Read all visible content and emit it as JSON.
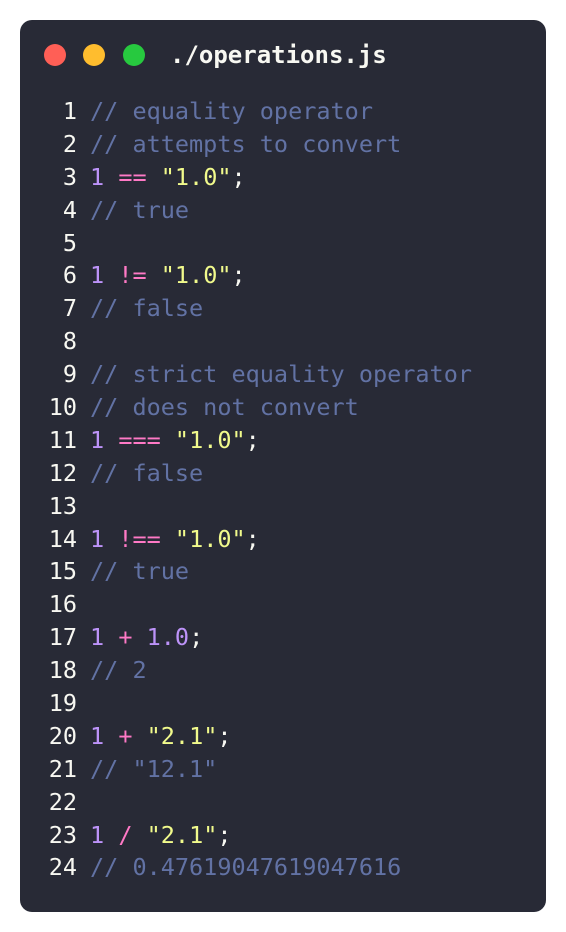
{
  "window": {
    "filename": "./operations.js"
  },
  "colors": {
    "background": "#282a36",
    "comment": "#6272a4",
    "number": "#bd93f9",
    "operator": "#ff79c6",
    "string": "#f1fa8c",
    "foreground": "#f8f8f2"
  },
  "lines": [
    {
      "n": "1",
      "tokens": [
        {
          "t": "comment",
          "v": "// equality operator"
        }
      ]
    },
    {
      "n": "2",
      "tokens": [
        {
          "t": "comment",
          "v": "// attempts to convert"
        }
      ]
    },
    {
      "n": "3",
      "tokens": [
        {
          "t": "number",
          "v": "1"
        },
        {
          "t": "space",
          "v": " "
        },
        {
          "t": "op",
          "v": "=="
        },
        {
          "t": "space",
          "v": " "
        },
        {
          "t": "string",
          "v": "\"1.0\""
        },
        {
          "t": "punct",
          "v": ";"
        }
      ]
    },
    {
      "n": "4",
      "tokens": [
        {
          "t": "comment",
          "v": "// true"
        }
      ]
    },
    {
      "n": "5",
      "tokens": []
    },
    {
      "n": "6",
      "tokens": [
        {
          "t": "number",
          "v": "1"
        },
        {
          "t": "space",
          "v": " "
        },
        {
          "t": "op",
          "v": "!="
        },
        {
          "t": "space",
          "v": " "
        },
        {
          "t": "string",
          "v": "\"1.0\""
        },
        {
          "t": "punct",
          "v": ";"
        }
      ]
    },
    {
      "n": "7",
      "tokens": [
        {
          "t": "comment",
          "v": "// false"
        }
      ]
    },
    {
      "n": "8",
      "tokens": []
    },
    {
      "n": "9",
      "tokens": [
        {
          "t": "comment",
          "v": "// strict equality operator"
        }
      ]
    },
    {
      "n": "10",
      "tokens": [
        {
          "t": "comment",
          "v": "// does not convert"
        }
      ]
    },
    {
      "n": "11",
      "tokens": [
        {
          "t": "number",
          "v": "1"
        },
        {
          "t": "space",
          "v": " "
        },
        {
          "t": "op",
          "v": "==="
        },
        {
          "t": "space",
          "v": " "
        },
        {
          "t": "string",
          "v": "\"1.0\""
        },
        {
          "t": "punct",
          "v": ";"
        }
      ]
    },
    {
      "n": "12",
      "tokens": [
        {
          "t": "comment",
          "v": "// false"
        }
      ]
    },
    {
      "n": "13",
      "tokens": []
    },
    {
      "n": "14",
      "tokens": [
        {
          "t": "number",
          "v": "1"
        },
        {
          "t": "space",
          "v": " "
        },
        {
          "t": "op",
          "v": "!=="
        },
        {
          "t": "space",
          "v": " "
        },
        {
          "t": "string",
          "v": "\"1.0\""
        },
        {
          "t": "punct",
          "v": ";"
        }
      ]
    },
    {
      "n": "15",
      "tokens": [
        {
          "t": "comment",
          "v": "// true"
        }
      ]
    },
    {
      "n": "16",
      "tokens": []
    },
    {
      "n": "17",
      "tokens": [
        {
          "t": "number",
          "v": "1"
        },
        {
          "t": "space",
          "v": " "
        },
        {
          "t": "op",
          "v": "+"
        },
        {
          "t": "space",
          "v": " "
        },
        {
          "t": "number",
          "v": "1.0"
        },
        {
          "t": "punct",
          "v": ";"
        }
      ]
    },
    {
      "n": "18",
      "tokens": [
        {
          "t": "comment",
          "v": "// 2"
        }
      ]
    },
    {
      "n": "19",
      "tokens": []
    },
    {
      "n": "20",
      "tokens": [
        {
          "t": "number",
          "v": "1"
        },
        {
          "t": "space",
          "v": " "
        },
        {
          "t": "op",
          "v": "+"
        },
        {
          "t": "space",
          "v": " "
        },
        {
          "t": "string",
          "v": "\"2.1\""
        },
        {
          "t": "punct",
          "v": ";"
        }
      ]
    },
    {
      "n": "21",
      "tokens": [
        {
          "t": "comment",
          "v": "// \"12.1\""
        }
      ]
    },
    {
      "n": "22",
      "tokens": []
    },
    {
      "n": "23",
      "tokens": [
        {
          "t": "number",
          "v": "1"
        },
        {
          "t": "space",
          "v": " "
        },
        {
          "t": "op",
          "v": "/"
        },
        {
          "t": "space",
          "v": " "
        },
        {
          "t": "string",
          "v": "\"2.1\""
        },
        {
          "t": "punct",
          "v": ";"
        }
      ]
    },
    {
      "n": "24",
      "tokens": [
        {
          "t": "comment",
          "v": "// 0.47619047619047616"
        }
      ]
    }
  ]
}
